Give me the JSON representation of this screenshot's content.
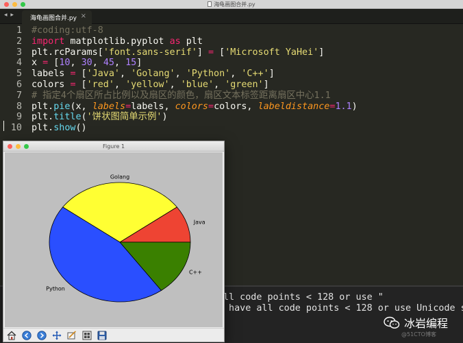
{
  "window": {
    "title": "海龟画图合并.py"
  },
  "tab": {
    "arrows": "◂ ▸",
    "label": "海龟画图合并.py",
    "close": "×"
  },
  "code": {
    "line_numbers": [
      "1",
      "2",
      "3",
      "4",
      "5",
      "6",
      "7",
      "8",
      "9",
      "10"
    ],
    "lines": [
      [
        {
          "t": "#coding:utf-8",
          "c": "c"
        }
      ],
      [
        {
          "t": "import",
          "c": "k"
        },
        {
          "t": " matplotlib.pyplot ",
          "c": ""
        },
        {
          "t": "as",
          "c": "k"
        },
        {
          "t": " plt",
          "c": ""
        }
      ],
      [
        {
          "t": "plt.rcParams[",
          "c": ""
        },
        {
          "t": "'font.sans-serif'",
          "c": "s"
        },
        {
          "t": "] ",
          "c": ""
        },
        {
          "t": "=",
          "c": "k"
        },
        {
          "t": " [",
          "c": ""
        },
        {
          "t": "'Microsoft YaHei'",
          "c": "s"
        },
        {
          "t": "]",
          "c": ""
        }
      ],
      [
        {
          "t": "x ",
          "c": ""
        },
        {
          "t": "=",
          "c": "k"
        },
        {
          "t": " [",
          "c": ""
        },
        {
          "t": "10",
          "c": "n"
        },
        {
          "t": ", ",
          "c": ""
        },
        {
          "t": "30",
          "c": "n"
        },
        {
          "t": ", ",
          "c": ""
        },
        {
          "t": "45",
          "c": "n"
        },
        {
          "t": ", ",
          "c": ""
        },
        {
          "t": "15",
          "c": "n"
        },
        {
          "t": "]",
          "c": ""
        }
      ],
      [
        {
          "t": "labels ",
          "c": ""
        },
        {
          "t": "=",
          "c": "k"
        },
        {
          "t": " [",
          "c": ""
        },
        {
          "t": "'Java'",
          "c": "s"
        },
        {
          "t": ", ",
          "c": ""
        },
        {
          "t": "'Golang'",
          "c": "s"
        },
        {
          "t": ", ",
          "c": ""
        },
        {
          "t": "'Python'",
          "c": "s"
        },
        {
          "t": ", ",
          "c": ""
        },
        {
          "t": "'C++'",
          "c": "s"
        },
        {
          "t": "]",
          "c": ""
        }
      ],
      [
        {
          "t": "colors ",
          "c": ""
        },
        {
          "t": "=",
          "c": "k"
        },
        {
          "t": " [",
          "c": ""
        },
        {
          "t": "'red'",
          "c": "s"
        },
        {
          "t": ", ",
          "c": ""
        },
        {
          "t": "'yellow'",
          "c": "s"
        },
        {
          "t": ", ",
          "c": ""
        },
        {
          "t": "'blue'",
          "c": "s"
        },
        {
          "t": ", ",
          "c": ""
        },
        {
          "t": "'green'",
          "c": "s"
        },
        {
          "t": "]",
          "c": ""
        }
      ],
      [
        {
          "t": "# 指定4个扇区所占比例以及扇区的颜色，扇区文本标签距离扇区中心1.1",
          "c": "c"
        }
      ],
      [
        {
          "t": "plt.",
          "c": ""
        },
        {
          "t": "pie",
          "c": "f"
        },
        {
          "t": "(x, ",
          "c": ""
        },
        {
          "t": "labels",
          "c": "a"
        },
        {
          "t": "=",
          "c": "k"
        },
        {
          "t": "labels, ",
          "c": ""
        },
        {
          "t": "colors",
          "c": "a"
        },
        {
          "t": "=",
          "c": "k"
        },
        {
          "t": "colors, ",
          "c": ""
        },
        {
          "t": "labeldistance",
          "c": "a"
        },
        {
          "t": "=",
          "c": "k"
        },
        {
          "t": "1.1",
          "c": "n"
        },
        {
          "t": ")",
          "c": ""
        }
      ],
      [
        {
          "t": "plt.",
          "c": ""
        },
        {
          "t": "title",
          "c": "f"
        },
        {
          "t": "(",
          "c": ""
        },
        {
          "t": "'饼状图简单示例'",
          "c": "s"
        },
        {
          "t": ")",
          "c": ""
        }
      ],
      [
        {
          "t": "plt.",
          "c": ""
        },
        {
          "t": "show",
          "c": "f"
        },
        {
          "t": "()",
          "c": ""
        }
      ]
    ]
  },
  "console": {
    "line1": "ll code points < 128 or use \"",
    "line2": " have all code points < 128 or use Unicode s"
  },
  "watermark": {
    "text": "冰岩编程",
    "sub": "@51CTO博客"
  },
  "figure": {
    "title": "Figure 1",
    "toolbar": [
      {
        "name": "home-icon"
      },
      {
        "name": "back-icon"
      },
      {
        "name": "forward-icon"
      },
      {
        "name": "pan-icon"
      },
      {
        "name": "zoom-icon"
      },
      {
        "name": "configure-subplots-icon"
      },
      {
        "name": "save-icon"
      }
    ]
  },
  "chart_data": {
    "type": "pie",
    "categories": [
      "Java",
      "Golang",
      "Python",
      "C++"
    ],
    "values": [
      10,
      30,
      45,
      15
    ],
    "colors": [
      "#ee4433",
      "#ffff33",
      "#2a4fff",
      "#3a8000"
    ],
    "start_angle_deg": 0,
    "direction": "counterclockwise",
    "labeldistance": 1.1,
    "title": ""
  }
}
